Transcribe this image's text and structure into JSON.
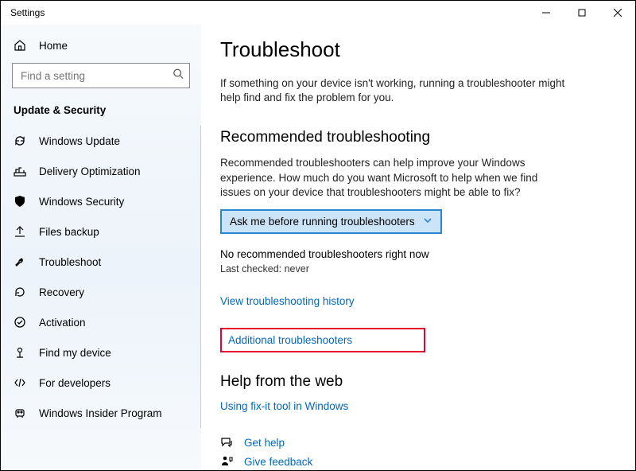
{
  "window": {
    "title": "Settings"
  },
  "sidebar": {
    "home": "Home",
    "search_placeholder": "Find a setting",
    "section": "Update & Security",
    "items": [
      {
        "label": "Windows Update"
      },
      {
        "label": "Delivery Optimization"
      },
      {
        "label": "Windows Security"
      },
      {
        "label": "Files backup"
      },
      {
        "label": "Troubleshoot"
      },
      {
        "label": "Recovery"
      },
      {
        "label": "Activation"
      },
      {
        "label": "Find my device"
      },
      {
        "label": "For developers"
      },
      {
        "label": "Windows Insider Program"
      }
    ]
  },
  "main": {
    "title": "Troubleshoot",
    "intro": "If something on your device isn't working, running a troubleshooter might help find and fix the problem for you.",
    "recommended": {
      "heading": "Recommended troubleshooting",
      "desc": "Recommended troubleshooters can help improve your Windows experience. How much do you want Microsoft to help when we find issues on your device that troubleshooters might be able to fix?",
      "dropdown_value": "Ask me before running troubleshooters",
      "status": "No recommended troubleshooters right now",
      "last_checked": "Last checked: never"
    },
    "history_link": "View troubleshooting history",
    "additional_link": "Additional troubleshooters",
    "help": {
      "heading": "Help from the web",
      "fixit": "Using fix-it tool in Windows",
      "get_help": "Get help",
      "feedback": "Give feedback"
    }
  }
}
